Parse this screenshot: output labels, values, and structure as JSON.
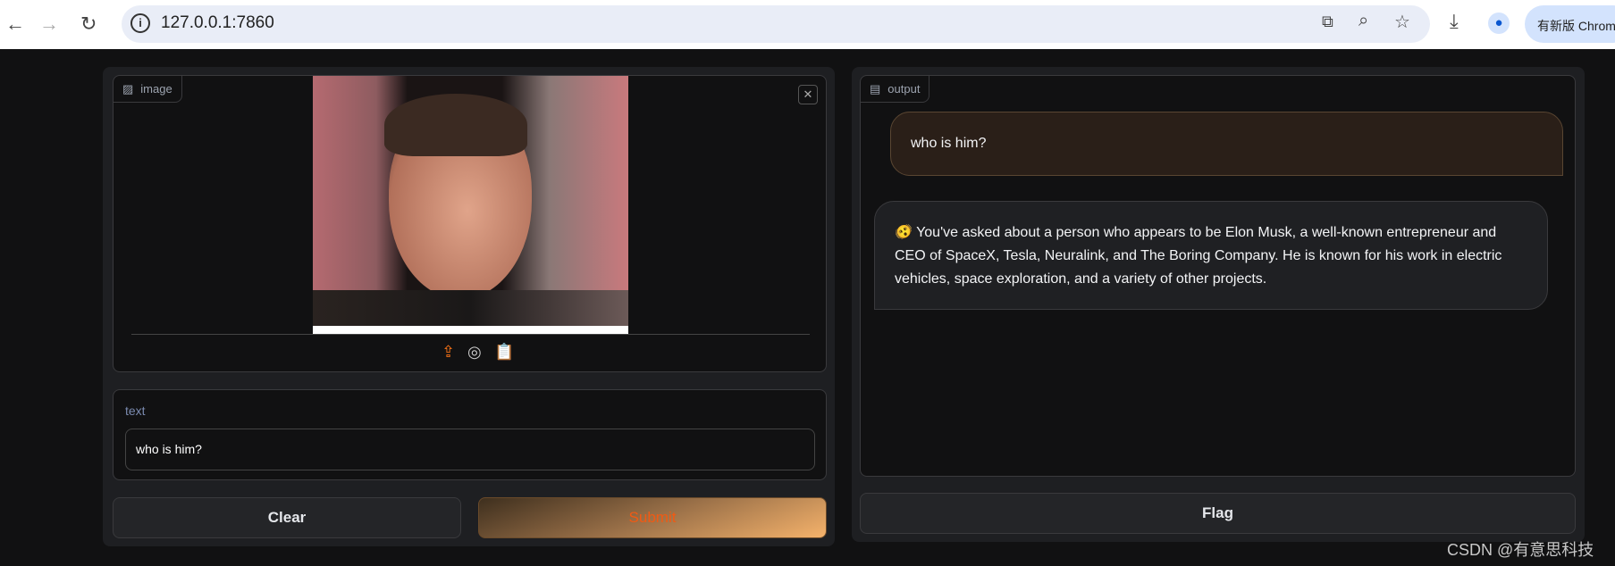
{
  "browser": {
    "url": "127.0.0.1:7860",
    "update_button": "有新版 Chrome"
  },
  "image_input": {
    "label": "image",
    "source_icons": [
      "upload-icon",
      "webcam-icon",
      "clipboard-icon"
    ]
  },
  "text_input": {
    "label": "text",
    "value": "who is him?"
  },
  "buttons": {
    "clear": "Clear",
    "submit": "Submit",
    "flag": "Flag"
  },
  "output": {
    "label": "output",
    "messages": [
      {
        "role": "user",
        "text": "who is him?"
      },
      {
        "role": "bot",
        "emoji": "🫨",
        "text": "You've asked about a person who appears to be Elon Musk, a well-known entrepreneur and CEO of SpaceX, Tesla, Neuralink, and The Boring Company. He is known for his work in electric vehicles, space exploration, and a variety of other projects."
      }
    ]
  },
  "watermark": "CSDN @有意思科技",
  "colors": {
    "accent": "#f97316",
    "submit_gradient_start": "#4a3a26",
    "submit_gradient_end": "#f5b26b",
    "user_bubble": "#2a1f18"
  }
}
